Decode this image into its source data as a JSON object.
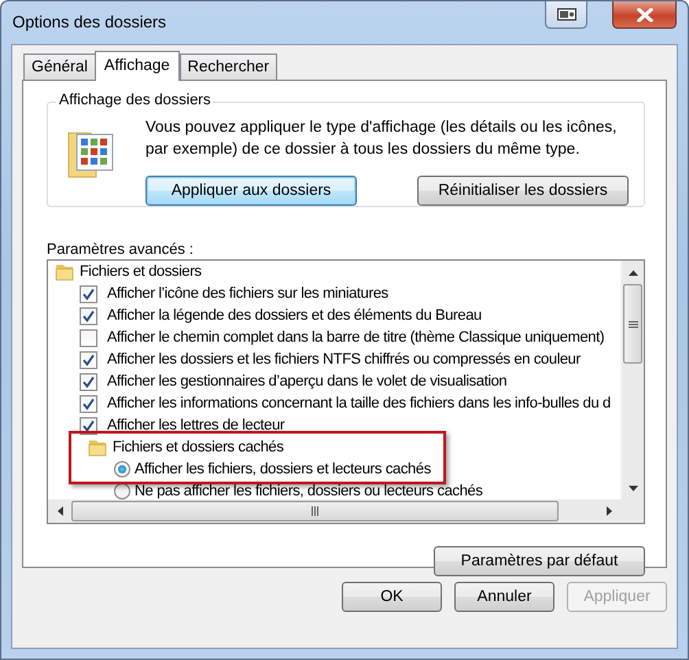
{
  "window": {
    "title": "Options des dossiers"
  },
  "tabs": [
    {
      "label": "Général",
      "selected": false
    },
    {
      "label": "Affichage",
      "selected": true
    },
    {
      "label": "Rechercher",
      "selected": false
    }
  ],
  "folder_view": {
    "title": "Affichage des dossiers",
    "description": "Vous pouvez appliquer le type d'affichage (les détails ou les icônes, par exemple) de ce dossier à tous les dossiers du même type.",
    "buttons": [
      {
        "label": "Appliquer aux dossiers",
        "focused": true
      },
      {
        "label": "Réinitialiser les dossiers",
        "focused": false
      }
    ]
  },
  "advanced": {
    "title": "Paramètres avancés :",
    "highlight_frame": true,
    "items": [
      {
        "kind": "folder",
        "label": "Fichiers et dossiers",
        "children": [
          {
            "kind": "checkbox",
            "label": "Afficher l’icône des fichiers sur les miniatures",
            "checked": true
          },
          {
            "kind": "checkbox",
            "label": "Afficher la légende des dossiers et des éléments du Bureau",
            "checked": true
          },
          {
            "kind": "checkbox",
            "label": "Afficher le chemin complet dans la barre de titre (thème Classique uniquement)",
            "checked": false
          },
          {
            "kind": "checkbox",
            "label": "Afficher les dossiers et les fichiers NTFS chiffrés ou compressés en couleur",
            "checked": true
          },
          {
            "kind": "checkbox",
            "label": "Afficher les gestionnaires d’aperçu dans le volet de visualisation",
            "checked": true
          },
          {
            "kind": "checkbox",
            "label": "Afficher les informations concernant la taille des fichiers dans les info-bulles du d",
            "checked": true
          },
          {
            "kind": "checkbox",
            "label": "Afficher les lettres de lecteur",
            "checked": true
          },
          {
            "kind": "folder",
            "label": "Fichiers et dossiers cachés",
            "children": [
              {
                "kind": "radio",
                "label": "Afficher les fichiers, dossiers et lecteurs cachés",
                "selected": true
              },
              {
                "kind": "radio",
                "label": "Ne pas afficher les fichiers, dossiers ou lecteurs cachés",
                "selected": false
              }
            ]
          }
        ]
      }
    ]
  },
  "defaults_button": "Paramètres par défaut",
  "dialog_buttons": [
    {
      "label": "OK",
      "disabled": false
    },
    {
      "label": "Annuler",
      "disabled": false
    },
    {
      "label": "Appliquer",
      "disabled": true
    }
  ]
}
